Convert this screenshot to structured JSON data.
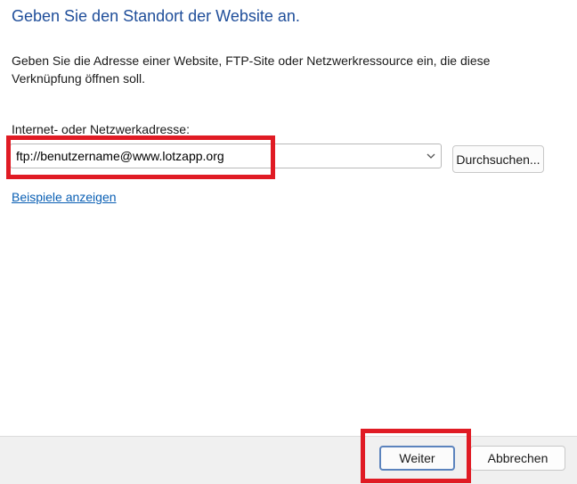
{
  "wizard": {
    "title": "Geben Sie den Standort der Website an.",
    "description": "Geben Sie die Adresse einer Website, FTP-Site oder Netzwerkressource ein, die diese Verknüpfung öffnen soll.",
    "address_label": "Internet- oder Netzwerkadresse:",
    "address_value": "ftp://benutzername@www.lotzapp.org",
    "browse_label": "Durchsuchen...",
    "examples_link": "Beispiele anzeigen"
  },
  "footer": {
    "next_label": "Weiter",
    "cancel_label": "Abbrechen"
  },
  "icons": {
    "combo_arrow": "chevron-down-icon"
  },
  "colors": {
    "title": "#1f4e9a",
    "link": "#0a5fb4",
    "highlight": "#e01b24",
    "footer_bg": "#f0f0f0",
    "default_button_border": "#5b83bd"
  }
}
